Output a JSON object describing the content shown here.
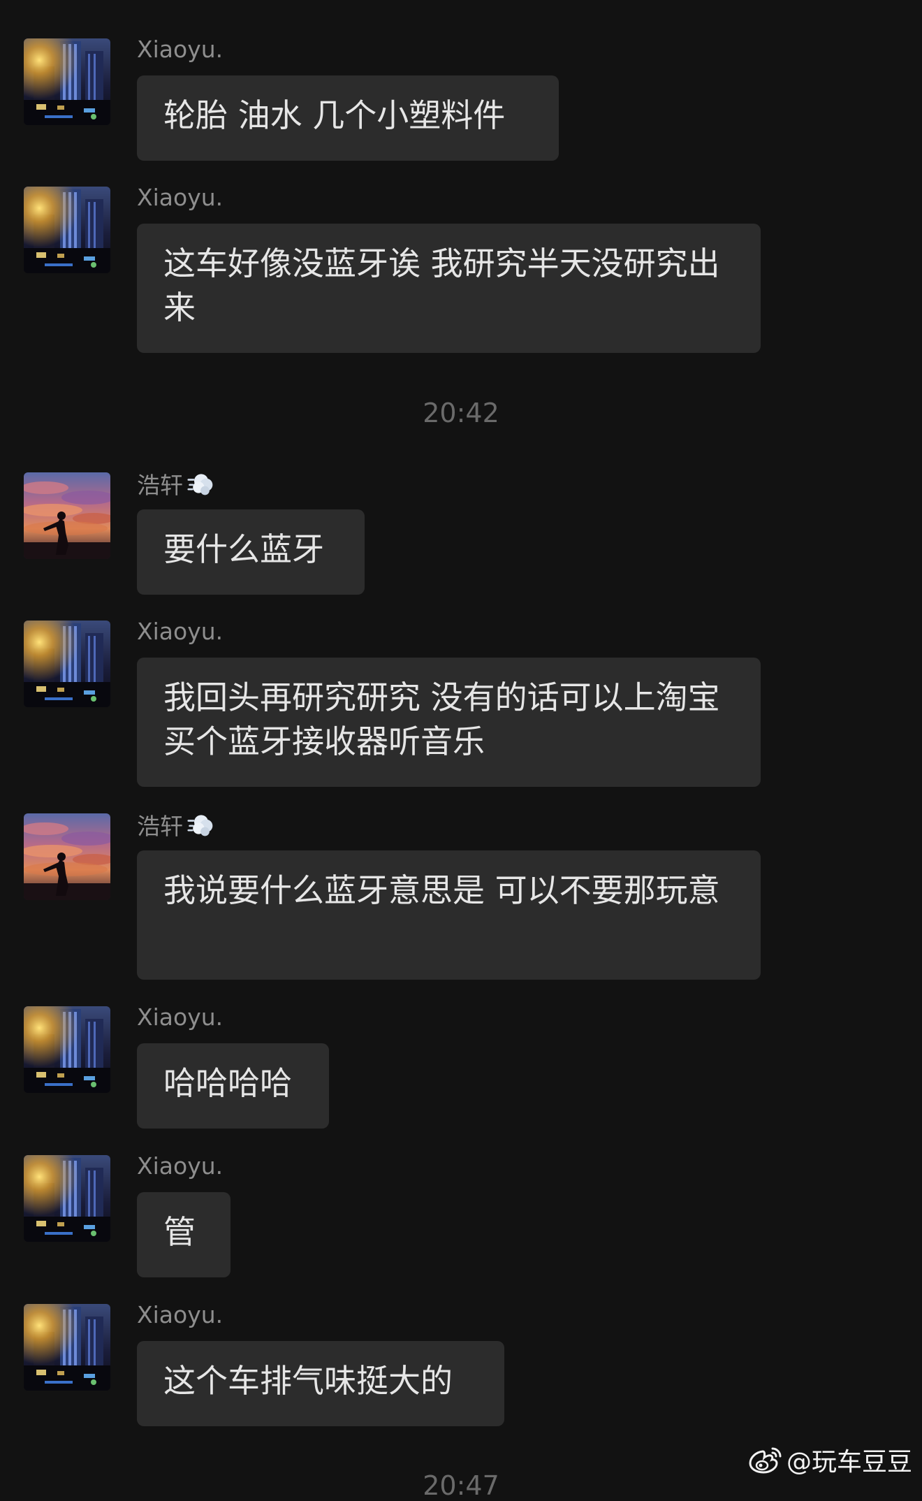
{
  "chat": {
    "messages": [
      {
        "sender": "Xiaoyu.",
        "text": "轮胎 油水 几个小塑料件"
      },
      {
        "sender": "Xiaoyu.",
        "text": "这车好像没蓝牙诶 我研究半天没研究出来"
      },
      {
        "sender": "浩轩",
        "text": "要什么蓝牙"
      },
      {
        "sender": "Xiaoyu.",
        "text": "我回头再研究研究 没有的话可以上淘宝买个蓝牙接收器听音乐"
      },
      {
        "sender": "浩轩",
        "text": "我说要什么蓝牙意思是 可以不要那玩意"
      },
      {
        "sender": "Xiaoyu.",
        "text": "哈哈哈哈"
      },
      {
        "sender": "Xiaoyu.",
        "text": "管"
      },
      {
        "sender": "Xiaoyu.",
        "text": "这个车排气味挺大的"
      }
    ],
    "timestamps": [
      "20:42",
      "20:47"
    ],
    "sender_badge_icon": "dash-cloud-emoji"
  },
  "watermark": {
    "icon": "weibo-logo-icon",
    "text": "@玩车豆豆"
  },
  "colors": {
    "background": "#121212",
    "bubble": "#2c2c2c",
    "message_text": "#e6e6e6",
    "sender_text": "#8e8e8e",
    "timestamp_text": "#6a6a6a"
  }
}
